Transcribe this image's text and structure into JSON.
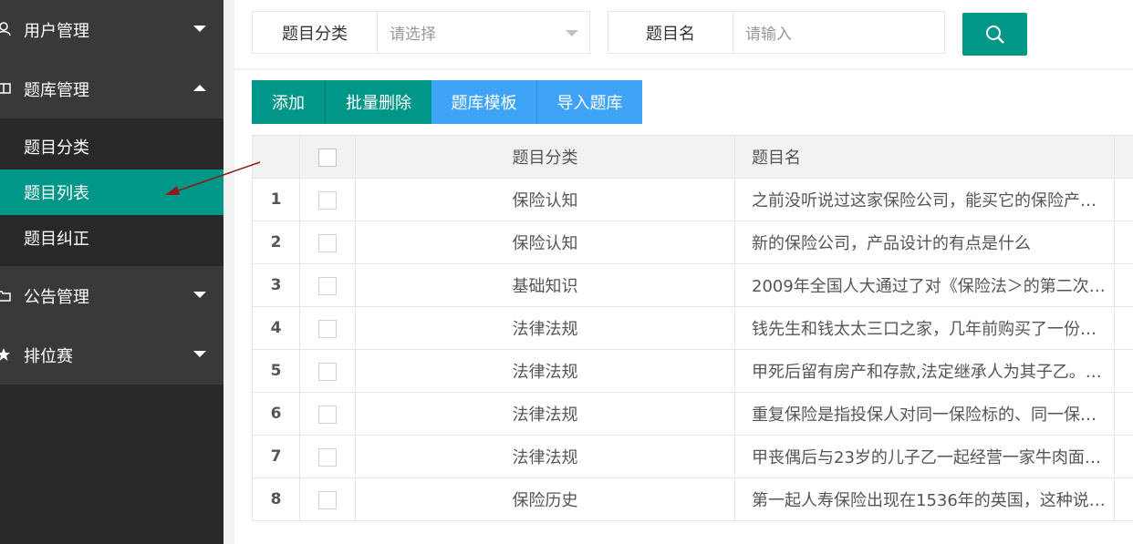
{
  "sidebar": {
    "groups": [
      {
        "label": "用户管理",
        "icon": "user-icon",
        "expanded": false
      },
      {
        "label": "题库管理",
        "icon": "book-icon",
        "expanded": true,
        "items": [
          {
            "label": "题目分类",
            "active": false
          },
          {
            "label": "题目列表",
            "active": true
          },
          {
            "label": "题目纠正",
            "active": false
          }
        ]
      },
      {
        "label": "公告管理",
        "icon": "folder-icon",
        "expanded": false
      },
      {
        "label": "排位赛",
        "icon": "star-icon",
        "expanded": false
      }
    ]
  },
  "filters": {
    "category_label": "题目分类",
    "category_placeholder": "请选择",
    "name_label": "题目名",
    "name_placeholder": "请输入",
    "search_icon": "search-icon"
  },
  "toolbar": {
    "add": "添加",
    "batch_delete": "批量删除",
    "template": "题库模板",
    "import": "导入题库"
  },
  "table": {
    "headers": {
      "category": "题目分类",
      "name": "题目名"
    },
    "rows": [
      {
        "no": "1",
        "category": "保险认知",
        "name": "之前没听说过这家保险公司，能买它的保险产…"
      },
      {
        "no": "2",
        "category": "保险认知",
        "name": "新的保险公司，产品设计的有点是什么"
      },
      {
        "no": "3",
        "category": "基础知识",
        "name": "2009年全国人大通过了对《保险法＞的第二次…"
      },
      {
        "no": "4",
        "category": "法律法规",
        "name": "钱先生和钱太太三口之家，几年前购买了一份…"
      },
      {
        "no": "5",
        "category": "法律法规",
        "name": "甲死后留有房产和存款,法定继承人为其子乙。…"
      },
      {
        "no": "6",
        "category": "法律法规",
        "name": "重复保险是指投保人对同一保险标的、同一保…"
      },
      {
        "no": "7",
        "category": "法律法规",
        "name": "甲丧偶后与23岁的儿子乙一起经营一家牛肉面…"
      },
      {
        "no": "8",
        "category": "保险历史",
        "name": "第一起人寿保险出现在1536年的英国，这种说…"
      }
    ]
  },
  "colors": {
    "accent": "#009688",
    "blue": "#3fa4f8",
    "sidebar_bg": "#282828",
    "sidebar_group": "#393939"
  }
}
